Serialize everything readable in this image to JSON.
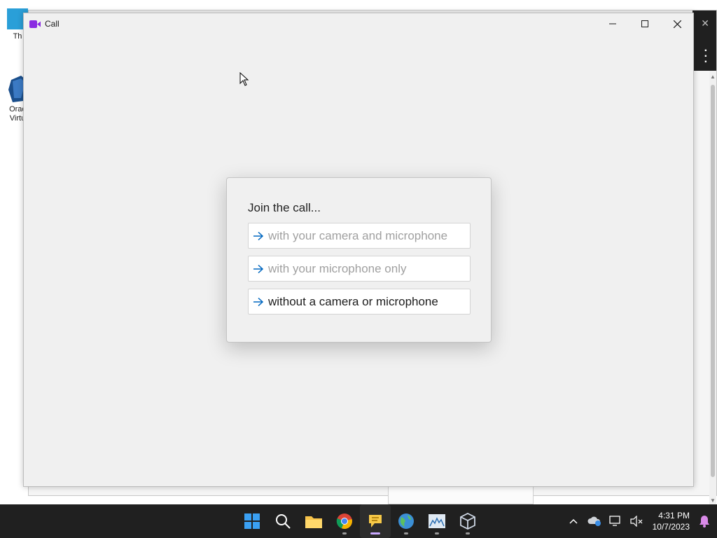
{
  "desktop": {
    "icon_top_label": "Th",
    "icon_vbox_label_line1": "Orac",
    "icon_vbox_label_line2": "Virtu"
  },
  "call_window": {
    "title": "Call",
    "accent_color": "#8a2be2",
    "controls": {
      "minimize": "—",
      "maximize": "☐",
      "close": "✕"
    }
  },
  "join_dialog": {
    "heading": "Join the call...",
    "options": [
      {
        "label": "with your camera and microphone",
        "enabled": false
      },
      {
        "label": "with your microphone only",
        "enabled": false
      },
      {
        "label": "without a camera or microphone",
        "enabled": true
      }
    ],
    "arrow_color": "#0067c0"
  },
  "taskbar": {
    "apps": [
      {
        "name": "start-icon"
      },
      {
        "name": "search-icon"
      },
      {
        "name": "file-explorer-icon"
      },
      {
        "name": "chrome-icon"
      },
      {
        "name": "chat-app-icon",
        "active": true
      },
      {
        "name": "maps-globe-icon"
      },
      {
        "name": "image-app-icon"
      },
      {
        "name": "virtualbox-icon"
      }
    ],
    "tray": {
      "time": "4:31 PM",
      "date": "10/7/2023"
    }
  }
}
